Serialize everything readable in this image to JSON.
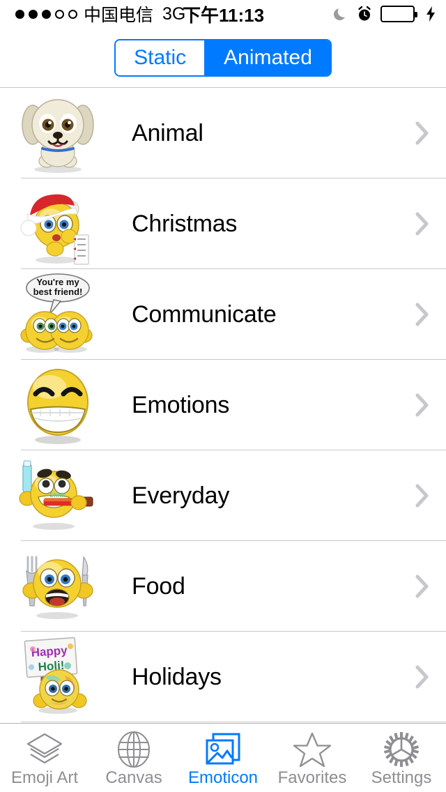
{
  "status_bar": {
    "signal_dots_filled": 3,
    "signal_dots_total": 5,
    "carrier": "中国电信",
    "network_type": "3G",
    "time": "下午11:13",
    "icons": [
      "moon-icon",
      "alarm-clock-icon",
      "battery-icon",
      "charging-bolt-icon"
    ],
    "battery_level_percent": 100,
    "battery_color": "#4cd964"
  },
  "header": {
    "segmented_control": {
      "options": [
        {
          "label": "Static",
          "selected": false
        },
        {
          "label": "Animated",
          "selected": true
        }
      ],
      "accent_color": "#007aff"
    }
  },
  "list": {
    "rows": [
      {
        "label": "Animal",
        "icon": "dog-emoticon",
        "accessory": "chevron-right-icon"
      },
      {
        "label": "Christmas",
        "icon": "santa-smiley-emoticon",
        "accessory": "chevron-right-icon"
      },
      {
        "label": "Communicate",
        "icon": "best-friends-emoticon",
        "accessory": "chevron-right-icon",
        "bubble_text_line1": "You're my",
        "bubble_text_line2": "best friend!"
      },
      {
        "label": "Emotions",
        "icon": "grinning-smiley-emoticon",
        "accessory": "chevron-right-icon"
      },
      {
        "label": "Everyday",
        "icon": "toothbrush-smiley-emoticon",
        "accessory": "chevron-right-icon"
      },
      {
        "label": "Food",
        "icon": "fork-knife-smiley-emoticon",
        "accessory": "chevron-right-icon"
      },
      {
        "label": "Holidays",
        "icon": "happy-holi-smiley-emoticon",
        "accessory": "chevron-right-icon",
        "sign_text_line1": "Happy",
        "sign_text_line2": "Holi!"
      }
    ],
    "separator_color": "#c8c7cc"
  },
  "tab_bar": {
    "active_color": "#007aff",
    "inactive_color": "#8e8e93",
    "tabs": [
      {
        "label": "Emoji Art",
        "icon": "layers-icon",
        "active": false
      },
      {
        "label": "Canvas",
        "icon": "globe-icon",
        "active": false
      },
      {
        "label": "Emoticon",
        "icon": "photos-icon",
        "active": true
      },
      {
        "label": "Favorites",
        "icon": "star-icon",
        "active": false
      },
      {
        "label": "Settings",
        "icon": "gear-icon",
        "active": false
      }
    ]
  }
}
